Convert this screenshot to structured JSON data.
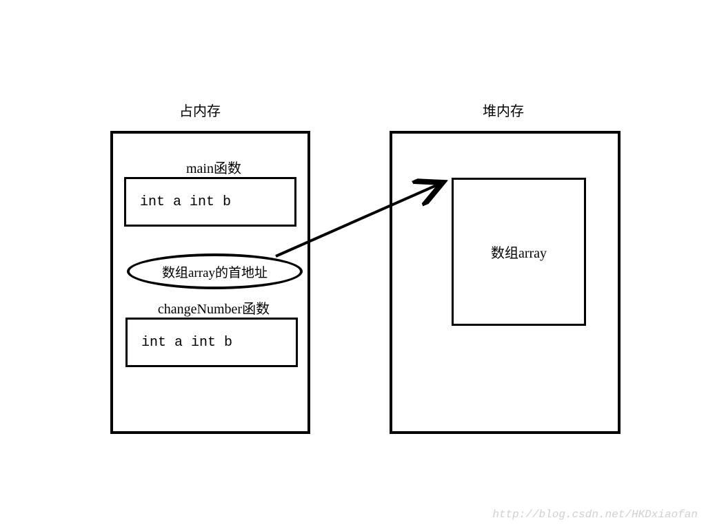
{
  "stack": {
    "title": "占内存",
    "main": {
      "label": "main函数",
      "vars": "int a   int  b"
    },
    "pointerText": "数组array的首地址",
    "change": {
      "label": "changeNumber函数",
      "vars": "int a   int  b"
    }
  },
  "heap": {
    "title": "堆内存",
    "arrayLabel": "数组array"
  },
  "watermark": "http://blog.csdn.net/HKDxiaofan"
}
